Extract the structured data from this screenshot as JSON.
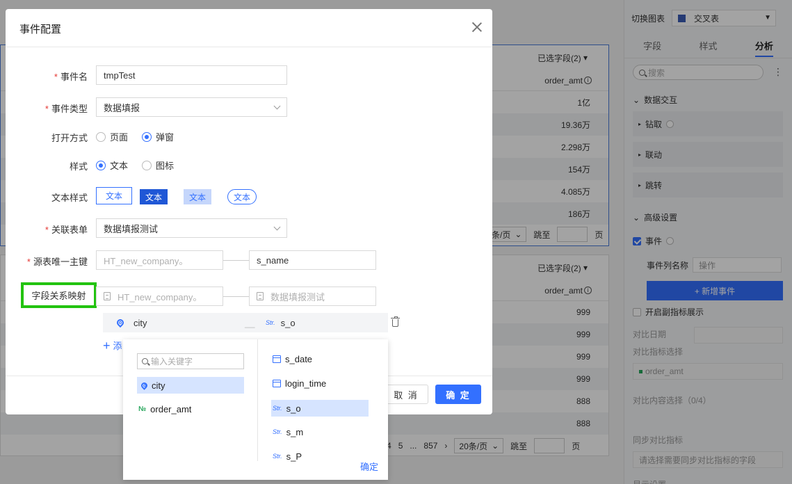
{
  "background": {
    "table1": {
      "selected_fields": "已选字段(2)",
      "column": "order_amt",
      "rows": [
        "1亿",
        "19.36万",
        "2.298万",
        "154万",
        "4.085万",
        "186万"
      ],
      "pager_size": "条/页",
      "jump_label": "跳至",
      "page_label": "页"
    },
    "table2": {
      "selected_fields": "已选字段(2)",
      "column": "order_amt",
      "rows": [
        "999",
        "999",
        "999",
        "999",
        "888",
        "888"
      ],
      "pager_pages": [
        "4",
        "5",
        "...",
        "857"
      ],
      "pager_size": "20条/页",
      "jump_label": "跳至",
      "page_label": "页"
    }
  },
  "right_panel": {
    "switch_chart_label": "切换图表",
    "chart_type": "交叉表",
    "tabs": [
      "字段",
      "样式",
      "分析"
    ],
    "active_tab": "分析",
    "search_placeholder": "搜索",
    "data_interaction": "数据交互",
    "drill": "钻取",
    "linkage": "联动",
    "jump": "跳转",
    "advanced": "高级设置",
    "event": "事件",
    "event_col_name_label": "事件列名称",
    "event_col_name_placeholder": "操作",
    "add_event_button": "+ 新增事件",
    "sub_indicator": "开启副指标展示",
    "compare_date": "对比日期",
    "compare_indicator": "对比指标选择",
    "compare_indicator_value": "order_amt",
    "compare_content": "对比内容选择（0/4）",
    "sync_compare": "同步对比指标",
    "sync_placeholder": "请选择需要同步对比指标的字段",
    "display_settings": "显示设置"
  },
  "dialog": {
    "title": "事件配置",
    "fields": {
      "event_name": {
        "label": "事件名",
        "value": "tmpTest"
      },
      "event_type": {
        "label": "事件类型",
        "value": "数据填报"
      },
      "open_mode": {
        "label": "打开方式",
        "options": [
          "页面",
          "弹窗"
        ],
        "selected": "弹窗"
      },
      "style": {
        "label": "样式",
        "options": [
          "文本",
          "图标"
        ],
        "selected": "文本"
      },
      "text_style": {
        "label": "文本样式",
        "options": [
          "文本",
          "文本",
          "文本",
          "文本"
        ]
      },
      "linked_form": {
        "label": "关联表单",
        "value": "数据填报测试"
      },
      "source_key": {
        "label": "源表唯一主键",
        "left_placeholder": "HT_new_company。",
        "right_value": "s_name"
      },
      "field_mapping": {
        "label": "字段关系映射",
        "left_placeholder": "HT_new_company。",
        "right_placeholder": "数据填报测试"
      }
    },
    "mapping_row": {
      "left": "city",
      "sep": "__",
      "right_type": "Str.",
      "right": "s_o"
    },
    "add_label": "添",
    "cancel_button": "取 消",
    "ok_button": "确 定"
  },
  "popup": {
    "search_placeholder": "输入关键字",
    "left_items": [
      {
        "icon": "pin",
        "label": "city",
        "selected": true
      },
      {
        "icon": "num",
        "label": "order_amt",
        "selected": false
      }
    ],
    "right_items": [
      {
        "icon": "date",
        "label": "s_date",
        "selected": false
      },
      {
        "icon": "date",
        "label": "login_time",
        "selected": false
      },
      {
        "icon": "Str.",
        "label": "s_o",
        "selected": true
      },
      {
        "icon": "Str.",
        "label": "s_m",
        "selected": false
      },
      {
        "icon": "Str.",
        "label": "s_P",
        "selected": false
      }
    ],
    "ok": "确定"
  },
  "colors": {
    "accent": "#3370ff",
    "highlight": "#22c30f",
    "required": "#e53935"
  }
}
